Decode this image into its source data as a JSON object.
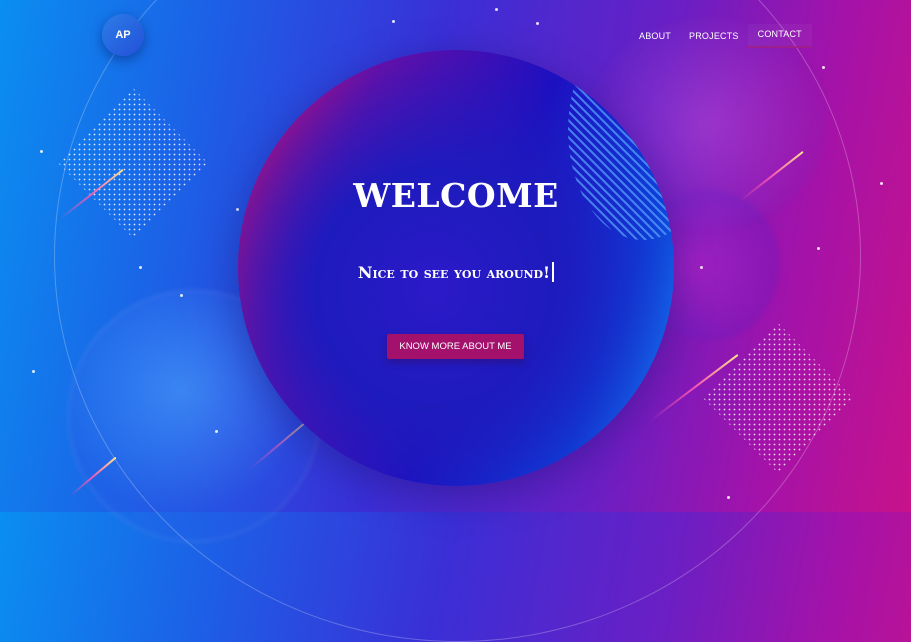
{
  "logo": {
    "initials": "AP"
  },
  "nav": {
    "items": [
      {
        "label": "ABOUT"
      },
      {
        "label": "PROJECTS"
      },
      {
        "label": "CONTACT"
      }
    ]
  },
  "hero": {
    "title": "WELCOME",
    "tagline": "Nice to see you around!",
    "cta_label": "KNOW MORE ABOUT ME"
  },
  "colors": {
    "cta": "#a3116d",
    "bg_left": "#0a8ef0",
    "bg_right": "#c8128a",
    "text": "#ffffff"
  }
}
